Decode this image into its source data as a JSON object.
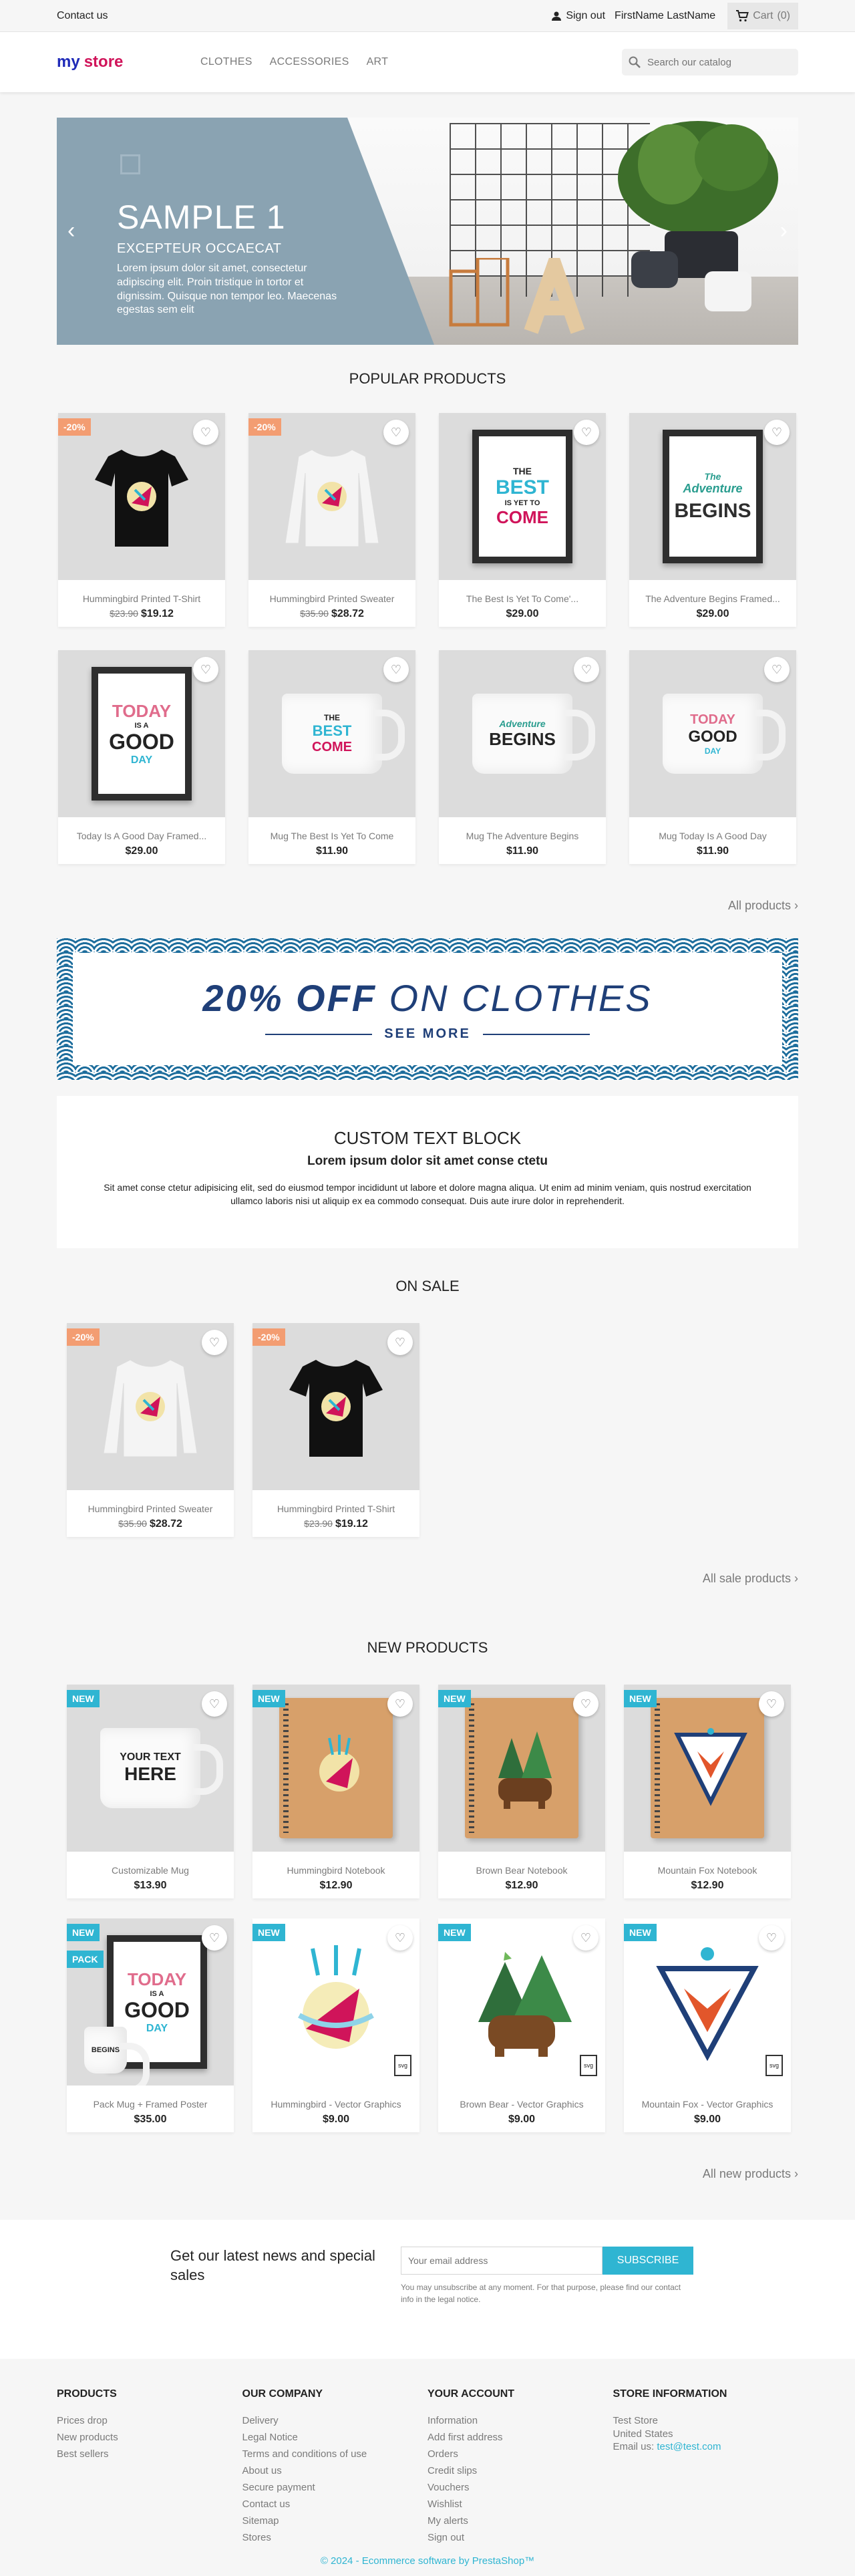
{
  "topnav": {
    "contact": "Contact us",
    "signout": "Sign out",
    "user": "FirstName LastName",
    "cart": "Cart",
    "cart_count": "(0)"
  },
  "header": {
    "logo_part1": "my",
    "logo_part2": "store",
    "menu": [
      "CLOTHES",
      "ACCESSORIES",
      "ART"
    ],
    "search_placeholder": "Search our catalog"
  },
  "slider": {
    "title": "SAMPLE 1",
    "subtitle": "EXCEPTEUR OCCAECAT",
    "text": "Lorem ipsum dolor sit amet, consectetur adipiscing elit. Proin tristique in tortor et dignissim. Quisque non tempor leo. Maecenas egestas sem elit",
    "prev": "‹",
    "next": "›"
  },
  "popular": {
    "title": "POPULAR PRODUCTS",
    "more": "All products",
    "products": [
      {
        "name": "Hummingbird Printed T-Shirt",
        "old": "$23.90",
        "price": "$19.12",
        "flag": "-20%"
      },
      {
        "name": "Hummingbird Printed Sweater",
        "old": "$35.90",
        "price": "$28.72",
        "flag": "-20%"
      },
      {
        "name": "The Best Is Yet To Come'...",
        "old": "",
        "price": "$29.00",
        "flag": ""
      },
      {
        "name": "The Adventure Begins Framed...",
        "old": "",
        "price": "$29.00",
        "flag": ""
      },
      {
        "name": "Today Is A Good Day Framed...",
        "old": "",
        "price": "$29.00",
        "flag": ""
      },
      {
        "name": "Mug The Best Is Yet To Come",
        "old": "",
        "price": "$11.90",
        "flag": ""
      },
      {
        "name": "Mug The Adventure Begins",
        "old": "",
        "price": "$11.90",
        "flag": ""
      },
      {
        "name": "Mug Today Is A Good Day",
        "old": "",
        "price": "$11.90",
        "flag": ""
      }
    ]
  },
  "promo": {
    "title_bold": "20% OFF",
    "title_rest": " ON CLOTHES",
    "cta": "SEE MORE"
  },
  "customtext": {
    "title": "CUSTOM TEXT BLOCK",
    "subtitle": "Lorem ipsum dolor sit amet conse ctetu",
    "body": "Sit amet conse ctetur adipisicing elit, sed do eiusmod tempor incididunt ut labore et dolore magna aliqua. Ut enim ad minim veniam, quis nostrud exercitation ullamco laboris nisi ut aliquip ex ea commodo consequat. Duis aute irure dolor in reprehenderit."
  },
  "onsale": {
    "title": "ON SALE",
    "more": "All sale products",
    "products": [
      {
        "name": "Hummingbird Printed Sweater",
        "old": "$35.90",
        "price": "$28.72",
        "flag": "-20%"
      },
      {
        "name": "Hummingbird Printed T-Shirt",
        "old": "$23.90",
        "price": "$19.12",
        "flag": "-20%"
      }
    ]
  },
  "newproducts": {
    "title": "NEW PRODUCTS",
    "more": "All new products",
    "products": [
      {
        "name": "Customizable Mug",
        "price": "$13.90",
        "flag": "NEW"
      },
      {
        "name": "Hummingbird Notebook",
        "price": "$12.90",
        "flag": "NEW"
      },
      {
        "name": "Brown Bear Notebook",
        "price": "$12.90",
        "flag": "NEW"
      },
      {
        "name": "Mountain Fox Notebook",
        "price": "$12.90",
        "flag": "NEW"
      },
      {
        "name": "Pack Mug + Framed Poster",
        "price": "$35.00",
        "flag": "NEW",
        "flag2": "PACK"
      },
      {
        "name": "Hummingbird - Vector Graphics",
        "price": "$9.00",
        "flag": "NEW"
      },
      {
        "name": "Brown Bear - Vector Graphics",
        "price": "$9.00",
        "flag": "NEW"
      },
      {
        "name": "Mountain Fox - Vector Graphics",
        "price": "$9.00",
        "flag": "NEW"
      }
    ]
  },
  "art_text": {
    "best1": "THE",
    "best2": "BEST",
    "best3": "IS YET TO",
    "best4": "COME",
    "adv1": "The",
    "adv2": "Adventure",
    "adv3": "BEGINS",
    "today1": "TODAY",
    "today2": "IS A",
    "today3": "GOOD",
    "today4": "DAY",
    "your1": "YOUR TEXT",
    "your2": "HERE",
    "wp": "svg"
  },
  "newsletter": {
    "title": "Get our latest news and special sales",
    "placeholder": "Your email address",
    "button": "SUBSCRIBE",
    "note": "You may unsubscribe at any moment. For that purpose, please find our contact info in the legal notice."
  },
  "footer": {
    "products": {
      "title": "PRODUCTS",
      "links": [
        "Prices drop",
        "New products",
        "Best sellers"
      ]
    },
    "company": {
      "title": "OUR COMPANY",
      "links": [
        "Delivery",
        "Legal Notice",
        "Terms and conditions of use",
        "About us",
        "Secure payment",
        "Contact us",
        "Sitemap",
        "Stores"
      ]
    },
    "account": {
      "title": "YOUR ACCOUNT",
      "links": [
        "Information",
        "Add first address",
        "Orders",
        "Credit slips",
        "Vouchers",
        "Wishlist",
        "My alerts",
        "Sign out"
      ]
    },
    "store": {
      "title": "STORE INFORMATION",
      "line1": "Test Store",
      "line2": "United States",
      "email_label": "Email us:",
      "email": "test@test.com"
    },
    "copyright": "© 2024 - Ecommerce software by PrestaShop™"
  },
  "colors": {
    "accent": "#2fb5d2",
    "discount": "#f39d72",
    "slider_panel": "#8aa3b2",
    "promo_blue": "#1f3f78"
  }
}
